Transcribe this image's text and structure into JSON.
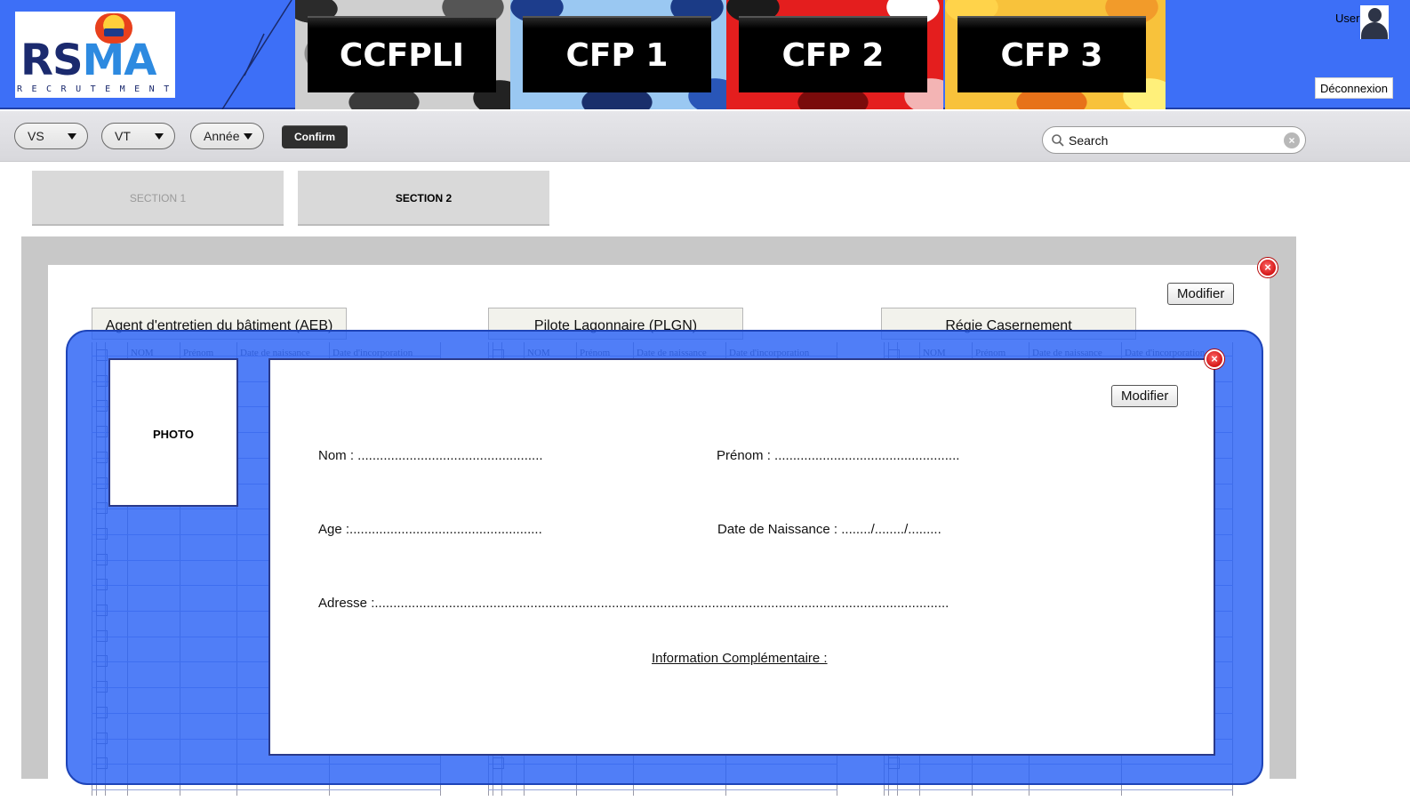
{
  "brand": {
    "logo_text_dark": "RS",
    "logo_text_light": "MA",
    "logo_sub": "RECRUTEMENT"
  },
  "header": {
    "tiles": [
      {
        "label": "CCFPLI"
      },
      {
        "label": "CFP 1"
      },
      {
        "label": "CFP 2"
      },
      {
        "label": "CFP 3"
      }
    ],
    "user_label": "User",
    "logout_label": "Déconnexion"
  },
  "toolbar": {
    "filters": [
      {
        "label": "VS"
      },
      {
        "label": "VT"
      },
      {
        "label": "Année"
      }
    ],
    "confirm_label": "Confirm",
    "search_placeholder": "Search"
  },
  "sections": [
    {
      "label": "SECTION 1",
      "active": false
    },
    {
      "label": "SECTION 2",
      "active": true
    }
  ],
  "main": {
    "modify_label": "Modifier",
    "groups": [
      {
        "title": "Agent d'entretien du bâtiment (AEB)"
      },
      {
        "title": "Pilote Lagonnaire (PLGN)"
      },
      {
        "title": "Régie Casernement"
      }
    ],
    "table_headers": [
      "NOM",
      "Prénom",
      "Date de naissance",
      "Date d'incorporation"
    ]
  },
  "modal": {
    "photo_label": "PHOTO",
    "modify_label": "Modifier",
    "fields": {
      "nom": "Nom : ..................................................",
      "prenom": "Prénom : ..................................................",
      "age": "Age :....................................................",
      "date_naissance": "Date de Naissance : ......../......../.........",
      "adresse": "Adresse :..........................................................................................................................................................."
    },
    "info_title": "Information Complémentaire :"
  },
  "colors": {
    "header_blue": "#3d6ff7",
    "modal_blue": "#2962f5",
    "close_red": "#d41515"
  }
}
